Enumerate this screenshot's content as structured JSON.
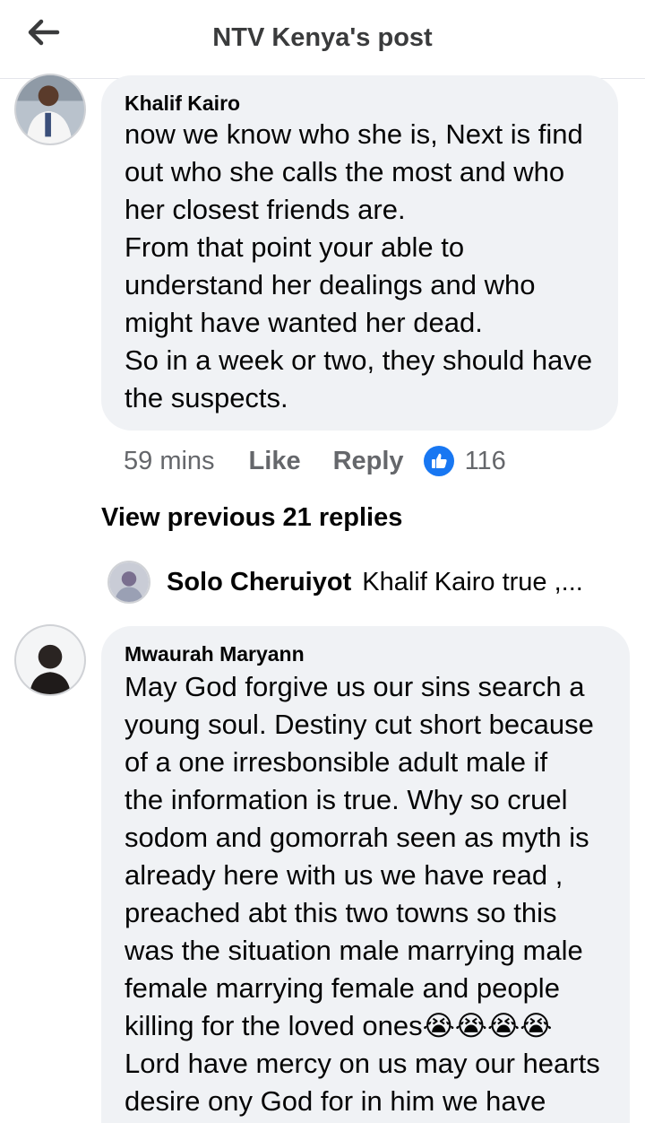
{
  "header": {
    "title": "NTV Kenya's post",
    "back_icon": "arrow-left-icon"
  },
  "comments": [
    {
      "author": "Khalif Kairo",
      "text": "now we know who she is, Next is find\nout who she calls the most and who\nher closest friends are.\nFrom that point your able to\nunderstand her dealings and who\nmight have wanted her dead.\nSo in a week or two, they should have\nthe suspects.",
      "time": "59 mins",
      "like_label": "Like",
      "reply_label": "Reply",
      "reaction_icon": "thumbs-up-icon",
      "reaction_count": "116"
    },
    {
      "author": "Mwaurah Maryann",
      "text": "May God forgive us our sins search a\nyoung soul. Destiny cut short because\nof a one irresbonsible adult male if\nthe information is true. Why so cruel\nsodom and gomorrah seen as myth is\nalready here with us we have read ,\npreached abt this two towns so this\nwas the situation male marrying male\nfemale marrying female and people\nkilling for the loved ones😭😭😭😭\nLord have mercy on us may our hearts\ndesire ony God for in him we have"
    }
  ],
  "view_previous": "View previous 21 replies",
  "reply_preview": {
    "author": "Solo Cheruiyot",
    "text": "Khalif Kairo true ,..."
  },
  "colors": {
    "accent": "#1877f2",
    "bubble": "#f0f2f5",
    "muted": "#65676b"
  }
}
